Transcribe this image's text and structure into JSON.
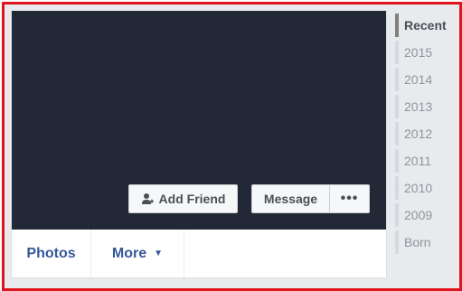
{
  "actions": {
    "add_friend_label": "Add Friend",
    "add_friend_icon": "add-person-icon",
    "message_label": "Message",
    "more_dots_label": "•••"
  },
  "tabs": [
    {
      "label": "Photos"
    },
    {
      "label": "More",
      "icon": "caret-down-icon"
    }
  ],
  "timeline": {
    "items": [
      {
        "label": "Recent",
        "active": true
      },
      {
        "label": "2015"
      },
      {
        "label": "2014"
      },
      {
        "label": "2013"
      },
      {
        "label": "2012"
      },
      {
        "label": "2011"
      },
      {
        "label": "2010"
      },
      {
        "label": "2009"
      },
      {
        "label": "Born"
      }
    ]
  },
  "colors": {
    "cover": "#222836",
    "link": "#365899",
    "frame": "#e0141b",
    "background": "#e9eaed"
  }
}
